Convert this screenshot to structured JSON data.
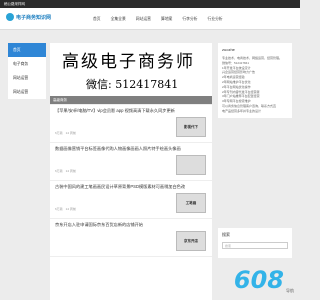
{
  "topbar": {
    "text": "稿公路采样网"
  },
  "header": {
    "logo_text": "电子商务知识网",
    "nav": [
      "首页",
      "全集全景",
      "网站运营",
      "算地案",
      "行李分析",
      "行业分析"
    ]
  },
  "sidebar": {
    "items": [
      {
        "label": "首页",
        "active": true
      },
      {
        "label": "电子商务",
        "active": false
      },
      {
        "label": "网站运营",
        "active": false
      },
      {
        "label": "网站运营",
        "active": false
      }
    ]
  },
  "banner": {
    "title": "高级电子商务师",
    "subtitle": "微信: 512417841",
    "caption": "高级商务"
  },
  "articles": [
    {
      "title": "【苹果/安卓/电脑/TV】vip会员影 app 视频高清下载永久同步更新",
      "views": "6万篇",
      "date": "14 周前",
      "thumb": "影视代下"
    },
    {
      "title": "数据画像营销平台标签画像代购人物画像画画人照片特手绘画头像画",
      "views": "6万篇",
      "date": "14 周前",
      "thumb": ""
    },
    {
      "title": "古装中国风的建工笔画画民设计草原背景PSD模版素材可画稍加白色改",
      "views": "6万篇",
      "date": "14 周前",
      "thumb": "工笔画"
    },
    {
      "title": "京东开店入驻申请国际京东百货店新的店铺开始",
      "views": "",
      "date": "",
      "thumb": "京东开店"
    }
  ],
  "right_panel": {
    "title": "zuozhe",
    "lines": [
      "专业技术，电商技术，网络运营，经营管理。",
      "微信号：512417841",
      "1年开发平台统设定计",
      "兴企运营经营影响力广告",
      "2年电商运营经验",
      "2年网站维护平台优化",
      "2年平台网站优化操作",
      "2年专刊内容代发平台经营者",
      "3年门户站推荐平台配置经营",
      "3年专网平台搜索维护",
      "可以商务信息管理客户咨询，联系方式直",
      "电产品经营多年并专业的设计"
    ]
  },
  "search": {
    "title": "搜索",
    "placeholder": "搜索"
  },
  "watermark": {
    "big": "608",
    "small": "导航"
  },
  "colors": {
    "accent": "#2f86d6",
    "logo": "#1d7fc0",
    "watermark": "#33b3e8"
  }
}
